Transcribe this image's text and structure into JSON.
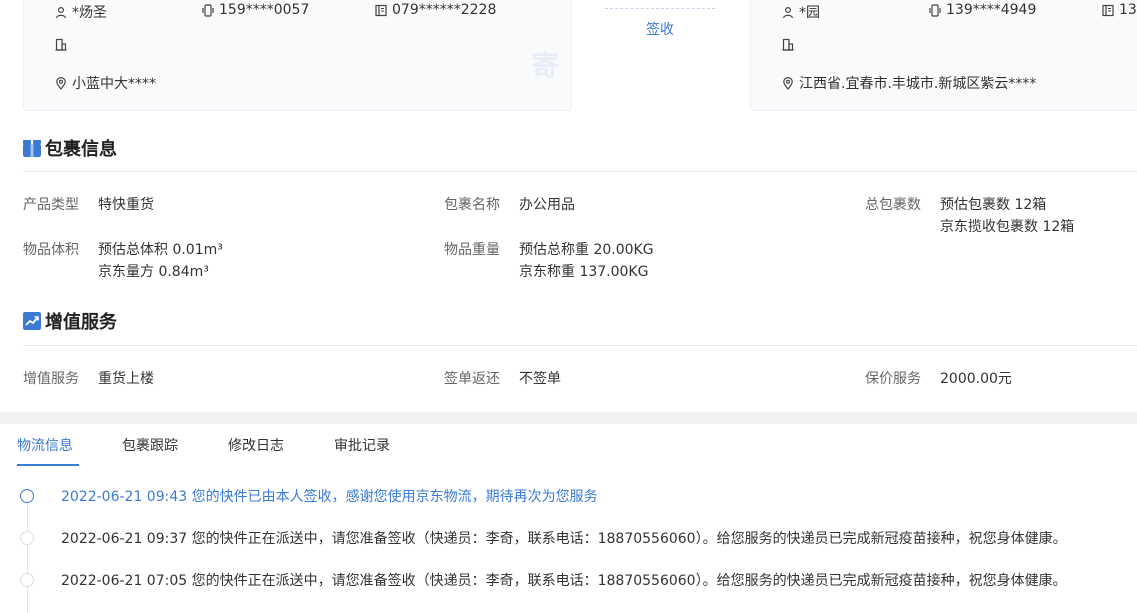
{
  "sender": {
    "name": "*炀圣",
    "mobile": "159****0057",
    "phone": "079******2228",
    "address": "小蓝中大****",
    "stamp": "寄"
  },
  "receiver": {
    "name": "*园",
    "mobile": "139****4949",
    "phone": "13",
    "address": "江西省.宜春市.丰城市.新城区紫云****"
  },
  "middle": {
    "sign_label": "签收"
  },
  "package_section": {
    "title": "包裹信息",
    "product_type_label": "产品类型",
    "product_type_value": "特快重货",
    "package_name_label": "包裹名称",
    "package_name_value": "办公用品",
    "total_packages_label": "总包裹数",
    "total_packages_line1": "预估包裹数 12箱",
    "total_packages_line2": "京东揽收包裹数 12箱",
    "volume_label": "物品体积",
    "volume_line1": "预估总体积 0.01m³",
    "volume_line2": "京东量方 0.84m³",
    "weight_label": "物品重量",
    "weight_line1": "预估总称重 20.00KG",
    "weight_line2": "京东称重 137.00KG"
  },
  "value_added_section": {
    "title": "增值服务",
    "service_label": "增值服务",
    "service_value": "重货上楼",
    "receipt_label": "签单返还",
    "receipt_value": "不签单",
    "insurance_label": "保价服务",
    "insurance_value": "2000.00元"
  },
  "tabs": [
    {
      "label": "物流信息"
    },
    {
      "label": "包裹跟踪"
    },
    {
      "label": "修改日志"
    },
    {
      "label": "审批记录"
    }
  ],
  "timeline": [
    {
      "text": "2022-06-21 09:43 您的快件已由本人签收，感谢您使用京东物流，期待再次为您服务"
    },
    {
      "text": "2022-06-21 09:37 您的快件正在派送中，请您准备签收（快递员：李奇，联系电话：18870556060）。给您服务的快递员已完成新冠疫苗接种，祝您身体健康。"
    },
    {
      "text": "2022-06-21 07:05 您的快件正在派送中，请您准备签收（快递员：李奇，联系电话：18870556060）。给您服务的快递员已完成新冠疫苗接种，祝您身体健康。"
    }
  ],
  "colors": {
    "accent": "#3b7bd4",
    "section_icon": "#3b7bd4"
  },
  "icons": {
    "person": "person-icon",
    "mobile": "mobile-phone-icon",
    "landline": "landline-phone-icon",
    "building": "building-icon",
    "location": "location-pin-icon"
  }
}
